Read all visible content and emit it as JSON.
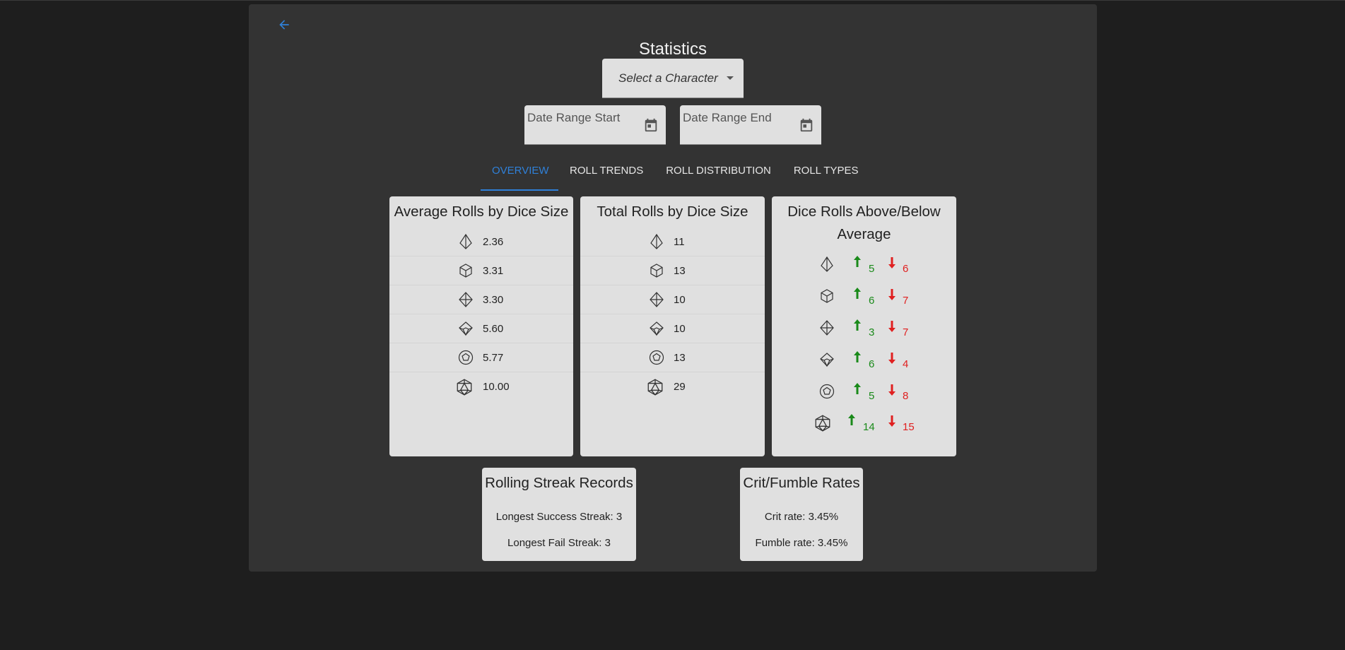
{
  "header": {
    "title": "Statistics",
    "back_icon": "arrow-left-icon"
  },
  "filters": {
    "character_select": {
      "value": "Select a Character"
    },
    "date_start": {
      "placeholder": "Date Range Start"
    },
    "date_end": {
      "placeholder": "Date Range End"
    }
  },
  "tabs": [
    {
      "label": "OVERVIEW",
      "active": true
    },
    {
      "label": "ROLL TRENDS",
      "active": false
    },
    {
      "label": "ROLL DISTRIBUTION",
      "active": false
    },
    {
      "label": "ROLL TYPES",
      "active": false
    }
  ],
  "average_rolls": {
    "title": "Average Rolls by Dice Size",
    "rows": [
      {
        "die": "d4-icon",
        "value": "2.36"
      },
      {
        "die": "d6-icon",
        "value": "3.31"
      },
      {
        "die": "d8-icon",
        "value": "3.30"
      },
      {
        "die": "d10-icon",
        "value": "5.60"
      },
      {
        "die": "d12-icon",
        "value": "5.77"
      },
      {
        "die": "d20-icon",
        "value": "10.00"
      }
    ]
  },
  "total_rolls": {
    "title": "Total Rolls by Dice Size",
    "rows": [
      {
        "die": "d4-icon",
        "value": "11"
      },
      {
        "die": "d6-icon",
        "value": "13"
      },
      {
        "die": "d8-icon",
        "value": "10"
      },
      {
        "die": "d10-icon",
        "value": "10"
      },
      {
        "die": "d12-icon",
        "value": "13"
      },
      {
        "die": "d20-icon",
        "value": "29"
      }
    ]
  },
  "above_below": {
    "title_line1": "Dice Rolls Above/Below",
    "title_line2": "Average",
    "rows": [
      {
        "die": "d4-icon",
        "above": "5",
        "below": "6"
      },
      {
        "die": "d6-icon",
        "above": "6",
        "below": "7"
      },
      {
        "die": "d8-icon",
        "above": "3",
        "below": "7"
      },
      {
        "die": "d10-icon",
        "above": "6",
        "below": "4"
      },
      {
        "die": "d12-icon",
        "above": "5",
        "below": "8"
      },
      {
        "die": "d20-icon",
        "above": "14",
        "below": "15"
      }
    ]
  },
  "streaks": {
    "title": "Rolling Streak Records",
    "success": "Longest Success Streak: 3",
    "fail": "Longest Fail Streak: 3"
  },
  "crit_fumble": {
    "title": "Crit/Fumble Rates",
    "crit": "Crit rate: 3.45%",
    "fumble": "Fumble rate: 3.45%"
  },
  "colors": {
    "accent": "#2f80d8",
    "above": "#1a8a1a",
    "below": "#e02020",
    "card_bg": "#e0e0e0",
    "panel_bg": "#333333"
  }
}
